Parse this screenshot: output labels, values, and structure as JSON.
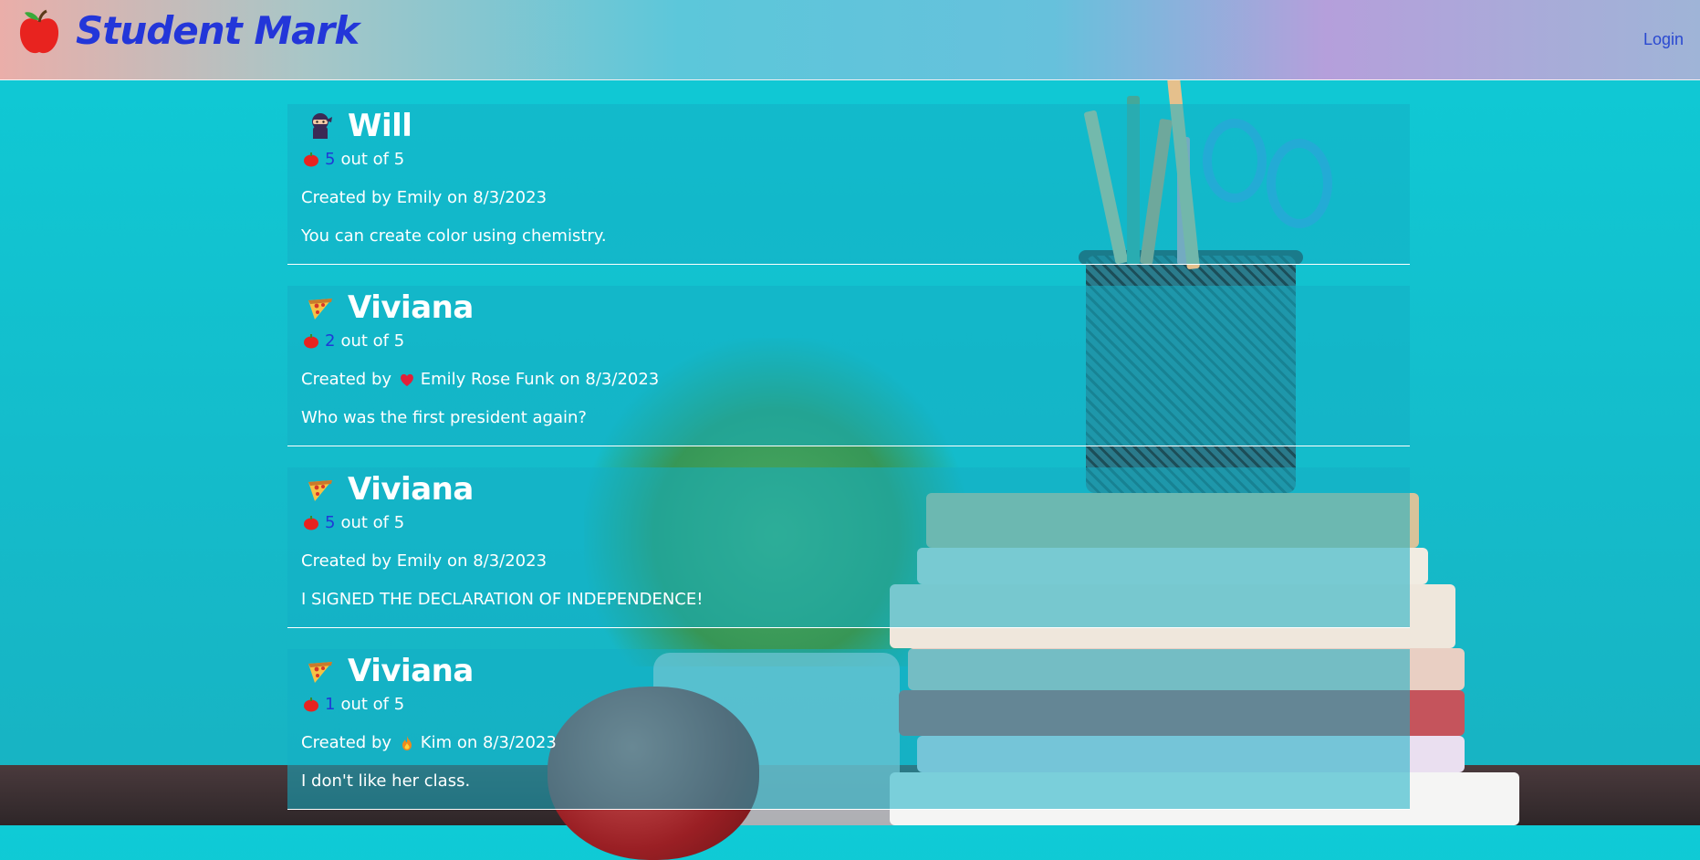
{
  "header": {
    "brand": "Student Mark",
    "login_label": "Login",
    "brand_color": "#2336d9"
  },
  "entries": [
    {
      "name": "Will",
      "avatar_icon": "ninja-icon",
      "rating_value": "5",
      "rating_suffix": "out of 5",
      "created_prefix": "Created by ",
      "author_icon": "",
      "author": "Emily",
      "created_suffix": " on 8/3/2023",
      "comment": "You can create color using chemistry."
    },
    {
      "name": "Viviana",
      "avatar_icon": "pizza-icon",
      "rating_value": "2",
      "rating_suffix": "out of 5",
      "created_prefix": "Created by ",
      "author_icon": "heart-icon",
      "author": "Emily Rose Funk",
      "created_suffix": " on 8/3/2023",
      "comment": "Who was the first president again?"
    },
    {
      "name": "Viviana",
      "avatar_icon": "pizza-icon",
      "rating_value": "5",
      "rating_suffix": "out of 5",
      "created_prefix": "Created by ",
      "author_icon": "",
      "author": "Emily",
      "created_suffix": " on 8/3/2023",
      "comment": "I SIGNED THE DECLARATION OF INDEPENDENCE!"
    },
    {
      "name": "Viviana",
      "avatar_icon": "pizza-icon",
      "rating_value": "1",
      "rating_suffix": "out of 5",
      "created_prefix": "Created by ",
      "author_icon": "fire-icon",
      "author": "Kim",
      "created_suffix": " on 8/3/2023",
      "comment": "I don't like her class."
    }
  ]
}
